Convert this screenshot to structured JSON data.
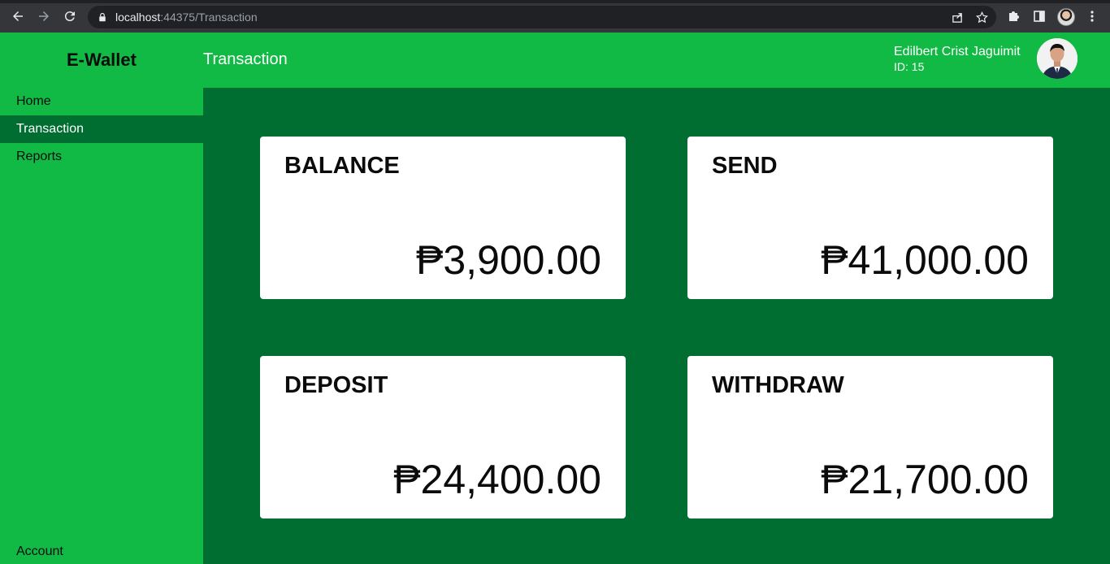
{
  "browser": {
    "url_host": "localhost",
    "url_rest": ":44375/Transaction"
  },
  "header": {
    "brand": "E-Wallet",
    "page_title": "Transaction",
    "user_name": "Edilbert Crist Jaguimit",
    "user_id": "ID: 15"
  },
  "sidebar": {
    "items": [
      {
        "label": "Home",
        "active": false
      },
      {
        "label": "Transaction",
        "active": true
      },
      {
        "label": "Reports",
        "active": false
      }
    ],
    "bottom_item": "Account"
  },
  "cards": {
    "balance": {
      "label": "BALANCE",
      "amount": "₱3,900.00"
    },
    "send": {
      "label": "SEND",
      "amount": "₱41,000.00"
    },
    "deposit": {
      "label": "DEPOSIT",
      "amount": "₱24,400.00"
    },
    "withdraw": {
      "label": "WITHDRAW",
      "amount": "₱21,700.00"
    }
  },
  "colors": {
    "header_green": "#11ba44",
    "content_green": "#006e31",
    "card_bg": "#ffffff"
  }
}
